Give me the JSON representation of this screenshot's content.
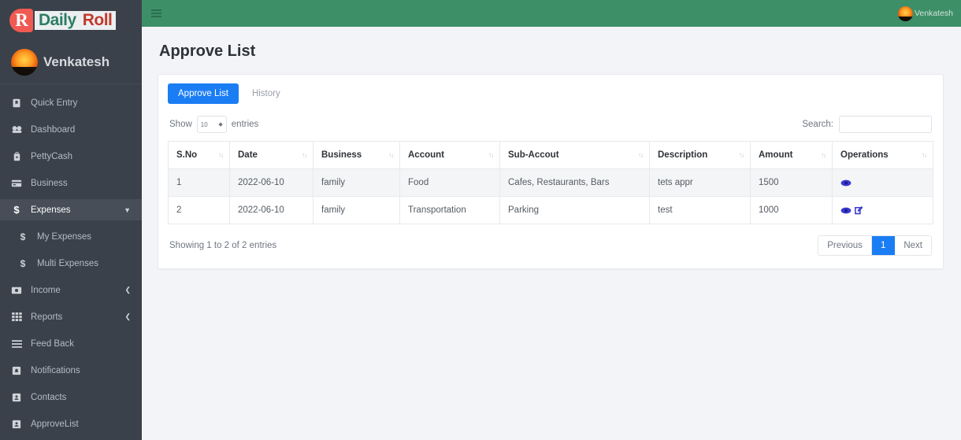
{
  "brand": {
    "badge": "R",
    "name_part1": "Daily",
    "name_part2": "Roll"
  },
  "sidebar": {
    "profile_name": "Venkatesh",
    "items": [
      {
        "label": "Quick Entry",
        "icon": "bookmark-icon",
        "active": false,
        "sub": false,
        "caret": ""
      },
      {
        "label": "Dashboard",
        "icon": "dashboard-icon",
        "active": false,
        "sub": false,
        "caret": ""
      },
      {
        "label": "PettyCash",
        "icon": "wallet-icon",
        "active": false,
        "sub": false,
        "caret": ""
      },
      {
        "label": "Business",
        "icon": "credit-card-icon",
        "active": false,
        "sub": false,
        "caret": ""
      },
      {
        "label": "Expenses",
        "icon": "dollar-icon",
        "active": true,
        "sub": false,
        "caret": "chevron-down-icon"
      },
      {
        "label": "My Expenses",
        "icon": "dollar-icon",
        "active": false,
        "sub": true,
        "caret": ""
      },
      {
        "label": "Multi Expenses",
        "icon": "dollar-icon",
        "active": false,
        "sub": true,
        "caret": ""
      },
      {
        "label": "Income",
        "icon": "money-icon",
        "active": false,
        "sub": false,
        "caret": "chevron-left-icon"
      },
      {
        "label": "Reports",
        "icon": "grid-icon",
        "active": false,
        "sub": false,
        "caret": "chevron-left-icon"
      },
      {
        "label": "Feed Back",
        "icon": "list-icon",
        "active": false,
        "sub": false,
        "caret": ""
      },
      {
        "label": "Notifications",
        "icon": "bell-box-icon",
        "active": false,
        "sub": false,
        "caret": ""
      },
      {
        "label": "Contacts",
        "icon": "contact-box-icon",
        "active": false,
        "sub": false,
        "caret": ""
      },
      {
        "label": "ApproveList",
        "icon": "approve-box-icon",
        "active": false,
        "sub": false,
        "caret": ""
      }
    ]
  },
  "navbar": {
    "menu_icon": "hamburger-icon",
    "user_name": "Venkatesh"
  },
  "page": {
    "title": "Approve List"
  },
  "tabs": [
    {
      "label": "Approve List",
      "active": true
    },
    {
      "label": "History",
      "active": false
    }
  ],
  "controls": {
    "show_label": "Show",
    "entries_label": "entries",
    "page_length": "10",
    "search_label": "Search:",
    "search_value": "",
    "search_placeholder": ""
  },
  "table": {
    "columns": [
      "S.No",
      "Date",
      "Business",
      "Account",
      "Sub-Accout",
      "Description",
      "Amount",
      "Operations"
    ],
    "sort_glyph": "↑↓",
    "rows": [
      {
        "sno": "1",
        "date": "2022-06-10",
        "business": "family",
        "account": "Food",
        "sub_account": "Cafes, Restaurants, Bars",
        "description": "tets appr",
        "amount": "1500",
        "ops": [
          "view-icon"
        ]
      },
      {
        "sno": "2",
        "date": "2022-06-10",
        "business": "family",
        "account": "Transportation",
        "sub_account": "Parking",
        "description": "test",
        "amount": "1000",
        "ops": [
          "view-icon",
          "edit-icon"
        ]
      }
    ]
  },
  "footer": {
    "info": "Showing 1 to 2 of 2 entries",
    "pagination": [
      {
        "label": "Previous",
        "active": false
      },
      {
        "label": "1",
        "active": true
      },
      {
        "label": "Next",
        "active": false
      }
    ]
  },
  "colors": {
    "navbar_green": "#3d8f68",
    "sidebar_dark": "#3a414a",
    "accent_blue": "#1b7df4",
    "brand_red": "#f05a52",
    "content_bg": "#f3f4f8"
  }
}
